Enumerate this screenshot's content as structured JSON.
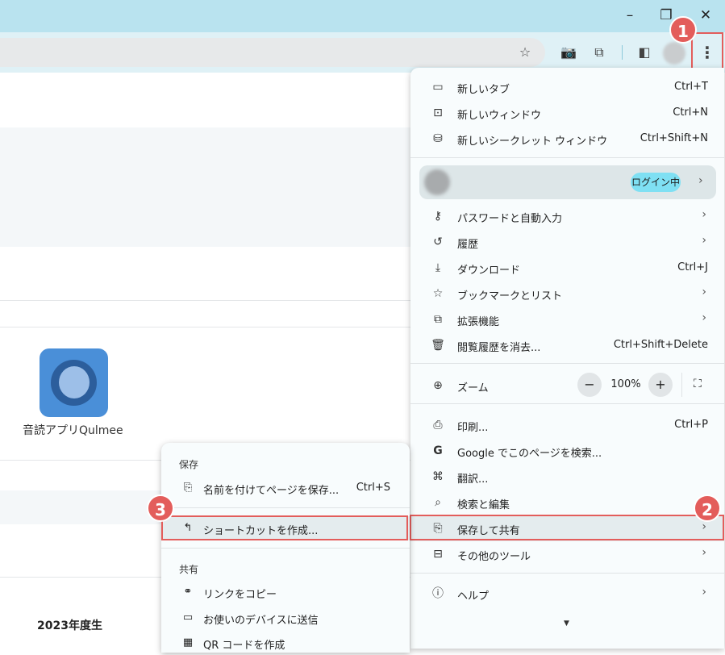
{
  "window": {
    "minimize_icon": "minimize-icon",
    "restore_icon": "restore-icon",
    "close_icon": "close-icon"
  },
  "toolbar": {
    "star_icon": "☆",
    "camera_icon": "📷",
    "extensions_icon": "⧉",
    "sidepanel_icon": "◧",
    "menu_icon": "⋮"
  },
  "page": {
    "app_label": "音読アプリQulmee",
    "year_label": "2023年度生"
  },
  "menu": {
    "new_tab": {
      "label": "新しいタブ",
      "shortcut": "Ctrl+T"
    },
    "new_window": {
      "label": "新しいウィンドウ",
      "shortcut": "Ctrl+N"
    },
    "incognito": {
      "label": "新しいシークレット ウィンドウ",
      "shortcut": "Ctrl+Shift+N"
    },
    "profile": {
      "name": "",
      "status": "ログイン中"
    },
    "passwords": {
      "label": "パスワードと自動入力"
    },
    "history": {
      "label": "履歴"
    },
    "downloads": {
      "label": "ダウンロード",
      "shortcut": "Ctrl+J"
    },
    "bookmarks": {
      "label": "ブックマークとリスト"
    },
    "extensions": {
      "label": "拡張機能"
    },
    "clear_data": {
      "label": "閲覧履歴を消去...",
      "shortcut": "Ctrl+Shift+Delete"
    },
    "zoom": {
      "label": "ズーム",
      "value": "100%",
      "minus": "−",
      "plus": "+"
    },
    "print": {
      "label": "印刷...",
      "shortcut": "Ctrl+P"
    },
    "google_search": {
      "label": "Google でこのページを検索..."
    },
    "translate": {
      "label": "翻訳..."
    },
    "find_edit": {
      "label": "検索と編集"
    },
    "save_share": {
      "label": "保存して共有"
    },
    "more_tools": {
      "label": "その他のツール"
    },
    "help": {
      "label": "ヘルプ"
    }
  },
  "submenu": {
    "save_header": "保存",
    "save_page": {
      "label": "名前を付けてページを保存...",
      "shortcut": "Ctrl+S"
    },
    "create_shortcut": {
      "label": "ショートカットを作成..."
    },
    "share_header": "共有",
    "copy_link": {
      "label": "リンクをコピー"
    },
    "send_devices": {
      "label": "お使いのデバイスに送信"
    },
    "qr_code": {
      "label": "QR コードを作成"
    }
  },
  "badges": {
    "one": "1",
    "two": "2",
    "three": "3"
  },
  "colors": {
    "accent_red": "#e35d5b",
    "titlebar": "#b9e3ef",
    "login_badge": "#7fe0f3"
  }
}
